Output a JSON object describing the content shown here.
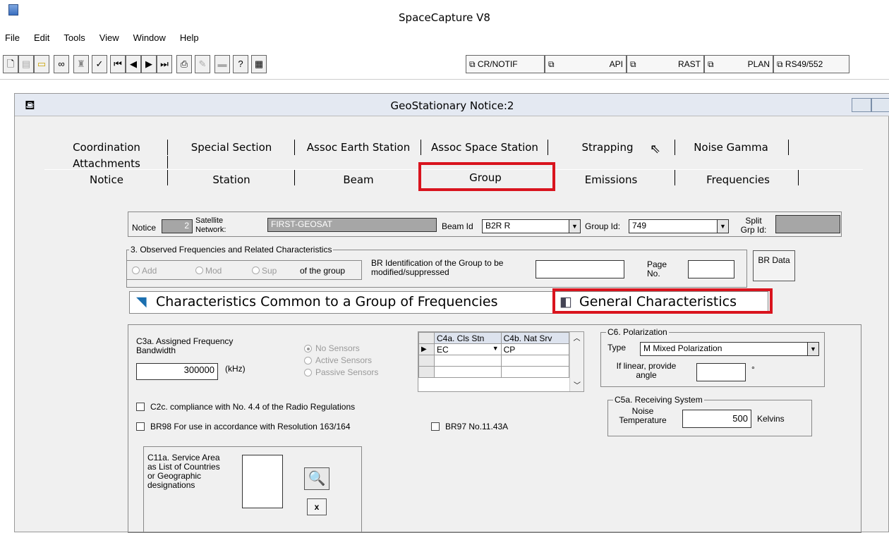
{
  "app": {
    "title": "SpaceCapture V8"
  },
  "menu": [
    "File",
    "Edit",
    "Tools",
    "View",
    "Window",
    "Help"
  ],
  "toolbar": {
    "nav_tabs": [
      "CR/NOTIF",
      "API",
      "RAST",
      "PLAN",
      "RS49/552"
    ]
  },
  "child_window": {
    "title": "GeoStationary Notice:2"
  },
  "tabs": {
    "row1": [
      "Coordination",
      "Special Section",
      "Assoc Earth Station",
      "Assoc Space Station",
      "Strapping",
      "Noise Gamma"
    ],
    "row2": [
      "Attachments"
    ],
    "row3": [
      "Notice",
      "Station",
      "Beam",
      "Group",
      "Emissions",
      "Frequencies"
    ]
  },
  "form": {
    "notice_label": "Notice",
    "notice_value": "2",
    "satellite_label": "Satellite Network:",
    "satellite_value": "FIRST-GEOSAT",
    "beam_label": "Beam Id",
    "beam_value": "B2R R",
    "group_label": "Group Id:",
    "group_value": "749",
    "split_label": "Split Grp Id:",
    "observed_title": "3. Observed Frequencies and Related Characteristics",
    "radio_add": "Add",
    "radio_mod": "Mod",
    "radio_sup": "Sup",
    "of_group": "of the group",
    "br_ident": "BR Identification of the Group to be modified/suppressed",
    "page_no": "Page No.",
    "br_data": "BR Data",
    "banner_common": "Characteristics Common to a Group of Frequencies",
    "banner_general": "General Characteristics",
    "c3a_label": "C3a. Assigned Frequency Bandwidth",
    "c3a_value": "300000",
    "c3a_unit": "(kHz)",
    "sensors": [
      "No Sensors",
      "Active Sensors",
      "Passive Sensors"
    ],
    "grid_headers": [
      "C4a. Cls Stn",
      "C4b. Nat Srv"
    ],
    "grid_row": [
      "EC",
      "CP"
    ],
    "c6_title": "C6. Polarization",
    "c6_type_label": "Type",
    "c6_type_value": "M  Mixed Polarization",
    "c6_angle_label": "If linear, provide angle",
    "c6_degree": "°",
    "c5a_title": "C5a. Receiving System",
    "c5a_noise_label": "Noise Temperature",
    "c5a_value": "500",
    "c5a_unit": "Kelvins",
    "c2c_label": "C2c. compliance with No. 4.4 of the Radio Regulations",
    "br98_label": "BR98 For use in accordance with Resolution 163/164",
    "br97_label": "BR97 No.11.43A",
    "c11a_label": "C11a. Service Area as List of Countries or Geographic designations",
    "clear_btn": "x"
  }
}
